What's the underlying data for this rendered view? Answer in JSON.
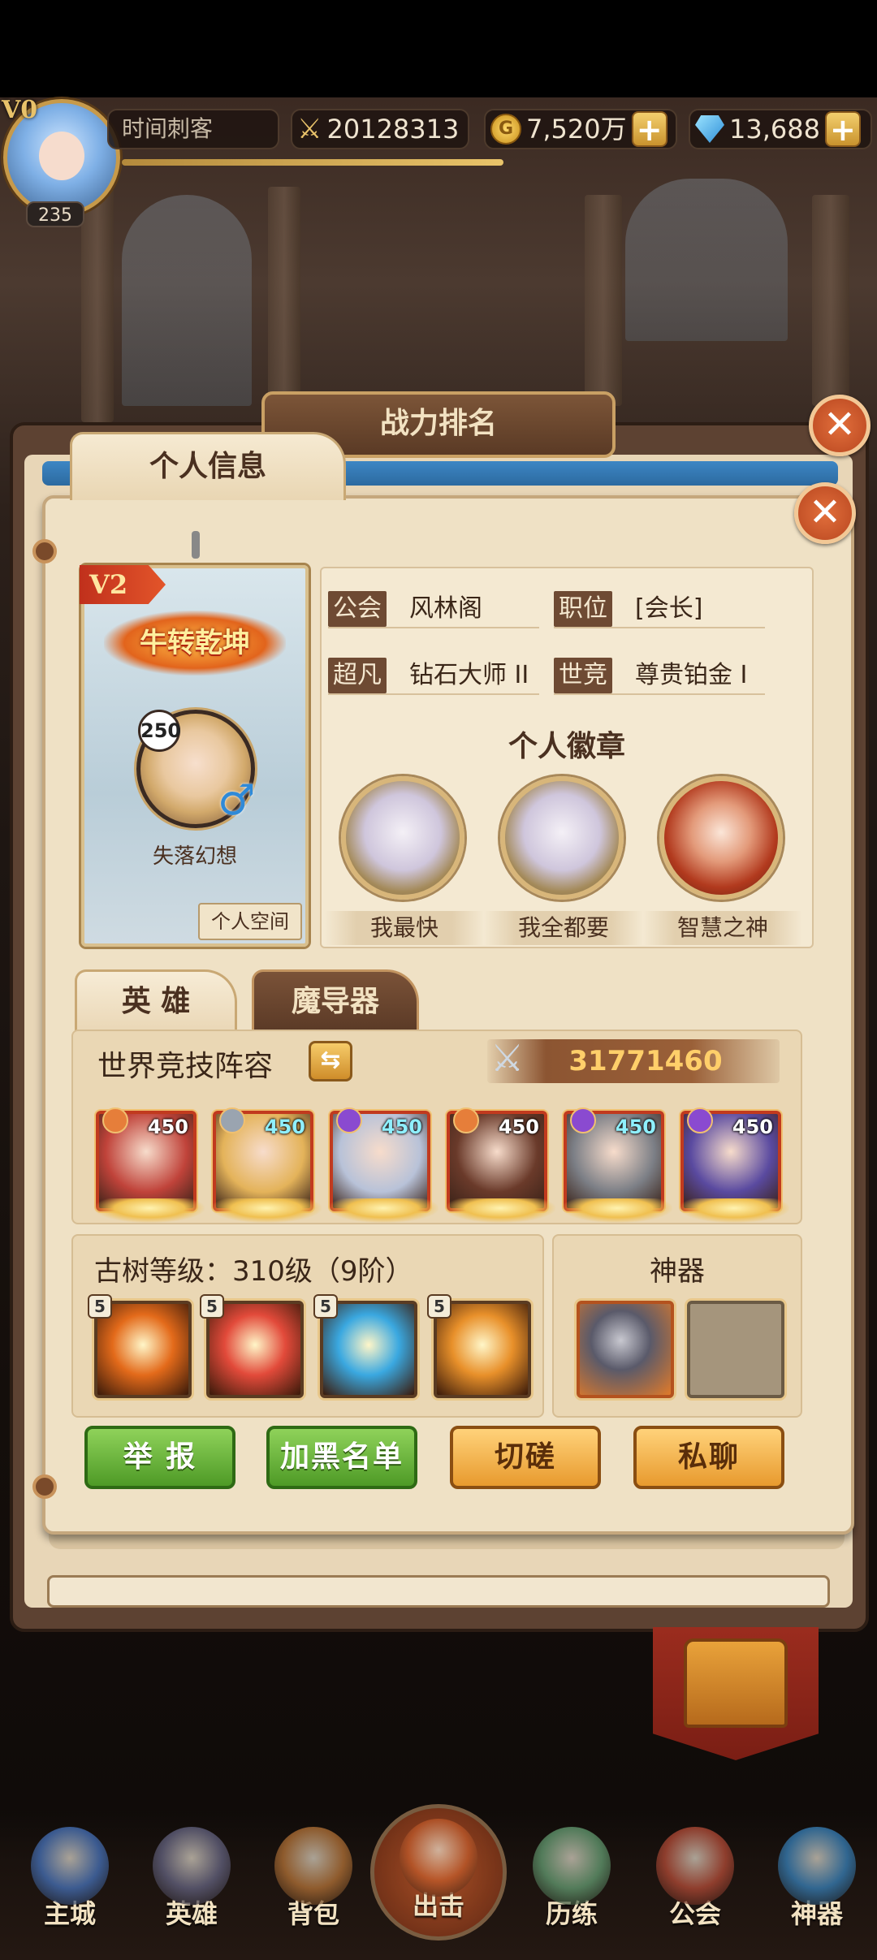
{
  "topbar": {
    "vip": "V0",
    "level": "235",
    "player_name": "时间刺客",
    "battle_power": "20128313",
    "gold": "7,520万",
    "gems": "13,688",
    "plus": "+"
  },
  "dialog": {
    "title": "战力排名",
    "close_glyph": "✕",
    "tab_personal": "个人信息"
  },
  "profile": {
    "vip": "V2",
    "title_badge": "牛转乾坤",
    "level": "250",
    "gender_glyph": "♂",
    "name": "失落幻想",
    "space_button": "个人空间"
  },
  "info": {
    "guild_label": "公会",
    "guild_value": "风林阁",
    "position_label": "职位",
    "position_value": "[会长]",
    "chaofan_label": "超凡",
    "chaofan_value": "钻石大师 II",
    "shijing_label": "世竞",
    "shijing_value": "尊贵铂金 I"
  },
  "badges": {
    "title": "个人徽章",
    "items": [
      {
        "label": "我最快"
      },
      {
        "label": "我全都要"
      },
      {
        "label": "智慧之神"
      }
    ]
  },
  "hero_tabs": {
    "heroes": "英 雄",
    "magitech": "魔导器"
  },
  "lineup": {
    "title": "世界竞技阵容",
    "swap_glyph": "⇆",
    "power": "31771460",
    "power_icon": "⚔",
    "heroes": [
      {
        "level": "450",
        "color": "#c0433a",
        "element": "#e67e3a"
      },
      {
        "level": "450",
        "color": "#e4b35a",
        "element": "#9aa4b0"
      },
      {
        "level": "450",
        "color": "#b8c2d8",
        "element": "#8a4ad0"
      },
      {
        "level": "450",
        "color": "#6a3a2a",
        "element": "#e67e3a"
      },
      {
        "level": "450",
        "color": "#7c7f86",
        "element": "#8a4ad0"
      },
      {
        "level": "450",
        "color": "#5a4aa0",
        "element": "#8a4ad0"
      }
    ]
  },
  "tree": {
    "title": "古树等级：310级（9阶）",
    "skills": [
      {
        "n": "5",
        "color": "#e36a1a"
      },
      {
        "n": "5",
        "color": "#e24a3a"
      },
      {
        "n": "5",
        "color": "#3aa8e0"
      },
      {
        "n": "5",
        "color": "#e8902a"
      }
    ]
  },
  "artifact": {
    "title": "神器"
  },
  "actions": {
    "report": "举 报",
    "blacklist": "加黑名单",
    "spar": "切磋",
    "chat": "私聊"
  },
  "nav": {
    "items": [
      {
        "label": "主城"
      },
      {
        "label": "英雄"
      },
      {
        "label": "背包"
      },
      {
        "label": "出击"
      },
      {
        "label": "历练"
      },
      {
        "label": "公会"
      },
      {
        "label": "神器"
      }
    ]
  }
}
